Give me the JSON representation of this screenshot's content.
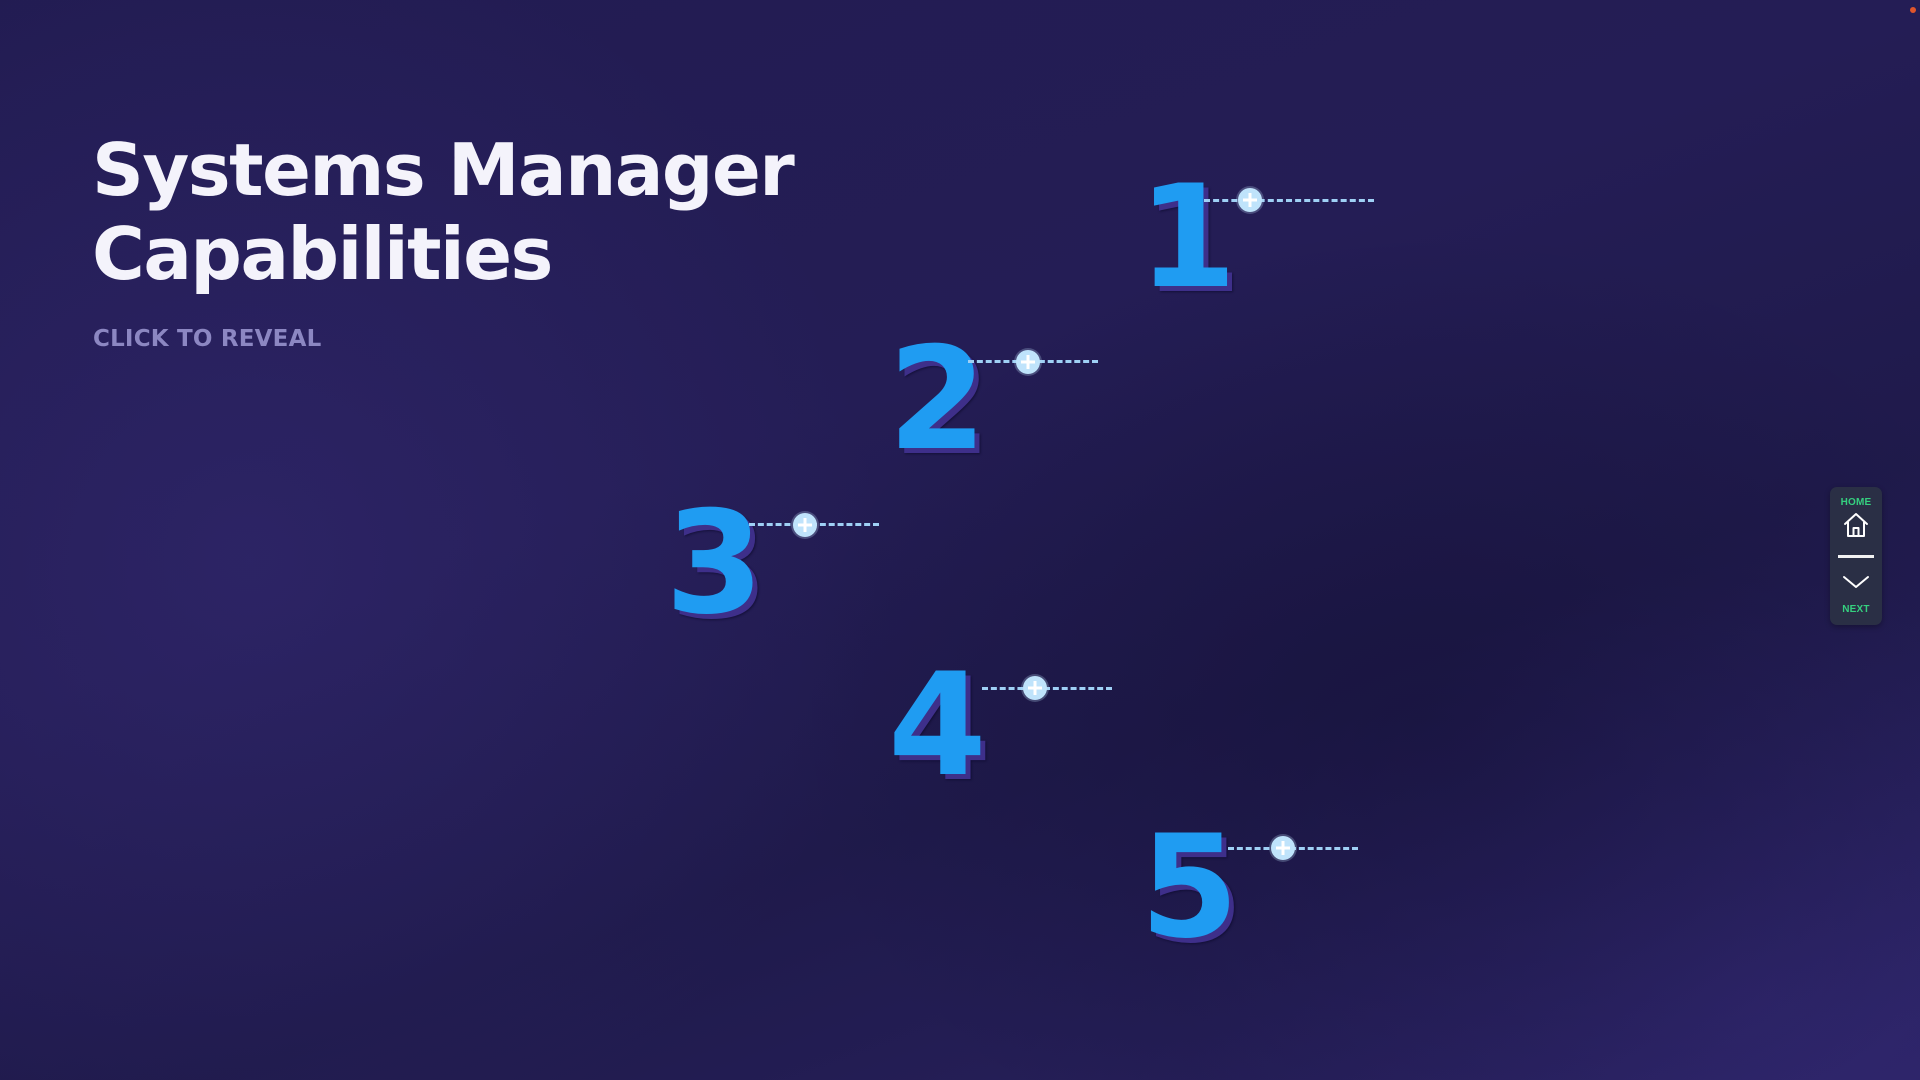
{
  "slide": {
    "title_line1": "Systems Manager",
    "title_line2": "Capabilities",
    "subtitle": "CLICK TO REVEAL"
  },
  "items": [
    {
      "number": "1"
    },
    {
      "number": "2"
    },
    {
      "number": "3"
    },
    {
      "number": "4"
    },
    {
      "number": "5"
    }
  ],
  "nav": {
    "home_label": "HOME",
    "next_label": "NEXT"
  },
  "colors": {
    "background": "#221c52",
    "number": "#1f9cf2",
    "number_shadow": "#3e2f8a",
    "plus": "#bfe3fb",
    "nav_label": "#35d07f",
    "title": "#f4f3fb",
    "subtitle": "#8c87c2"
  },
  "icons": {
    "home": "home-icon",
    "next": "chevron-down-icon",
    "reveal": "plus-circle-icon"
  }
}
